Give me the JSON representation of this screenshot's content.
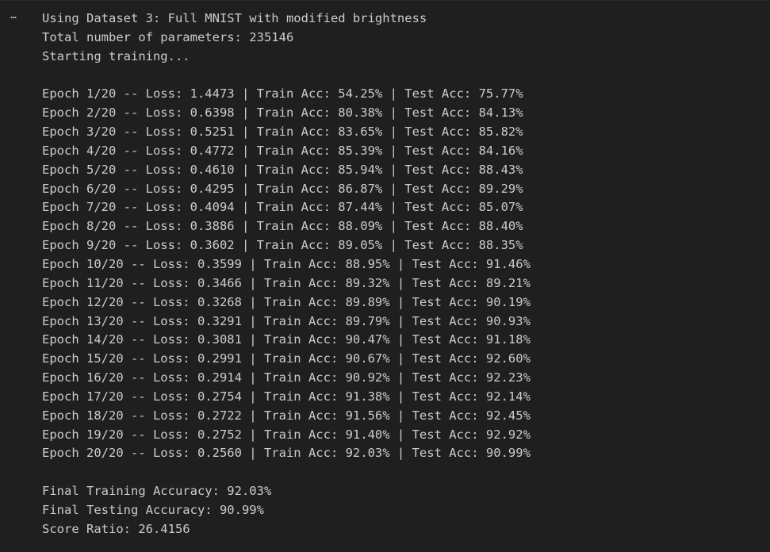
{
  "cell": {
    "more_icon": "⋯"
  },
  "output": {
    "header": [
      "Using Dataset 3: Full MNIST with modified brightness",
      "Total number of parameters: 235146",
      "Starting training..."
    ],
    "epochs": [
      "Epoch 1/20 -- Loss: 1.4473 | Train Acc: 54.25% | Test Acc: 75.77%",
      "Epoch 2/20 -- Loss: 0.6398 | Train Acc: 80.38% | Test Acc: 84.13%",
      "Epoch 3/20 -- Loss: 0.5251 | Train Acc: 83.65% | Test Acc: 85.82%",
      "Epoch 4/20 -- Loss: 0.4772 | Train Acc: 85.39% | Test Acc: 84.16%",
      "Epoch 5/20 -- Loss: 0.4610 | Train Acc: 85.94% | Test Acc: 88.43%",
      "Epoch 6/20 -- Loss: 0.4295 | Train Acc: 86.87% | Test Acc: 89.29%",
      "Epoch 7/20 -- Loss: 0.4094 | Train Acc: 87.44% | Test Acc: 85.07%",
      "Epoch 8/20 -- Loss: 0.3886 | Train Acc: 88.09% | Test Acc: 88.40%",
      "Epoch 9/20 -- Loss: 0.3602 | Train Acc: 89.05% | Test Acc: 88.35%",
      "Epoch 10/20 -- Loss: 0.3599 | Train Acc: 88.95% | Test Acc: 91.46%",
      "Epoch 11/20 -- Loss: 0.3466 | Train Acc: 89.32% | Test Acc: 89.21%",
      "Epoch 12/20 -- Loss: 0.3268 | Train Acc: 89.89% | Test Acc: 90.19%",
      "Epoch 13/20 -- Loss: 0.3291 | Train Acc: 89.79% | Test Acc: 90.93%",
      "Epoch 14/20 -- Loss: 0.3081 | Train Acc: 90.47% | Test Acc: 91.18%",
      "Epoch 15/20 -- Loss: 0.2991 | Train Acc: 90.67% | Test Acc: 92.60%",
      "Epoch 16/20 -- Loss: 0.2914 | Train Acc: 90.92% | Test Acc: 92.23%",
      "Epoch 17/20 -- Loss: 0.2754 | Train Acc: 91.38% | Test Acc: 92.14%",
      "Epoch 18/20 -- Loss: 0.2722 | Train Acc: 91.56% | Test Acc: 92.45%",
      "Epoch 19/20 -- Loss: 0.2752 | Train Acc: 91.40% | Test Acc: 92.92%",
      "Epoch 20/20 -- Loss: 0.2560 | Train Acc: 92.03% | Test Acc: 90.99%"
    ],
    "summary": [
      "Final Training Accuracy: 92.03%",
      "Final Testing Accuracy: 90.99%",
      "Score Ratio: 26.4156"
    ]
  },
  "colors": {
    "background": "#1f1f1f",
    "text": "#cccccc"
  }
}
